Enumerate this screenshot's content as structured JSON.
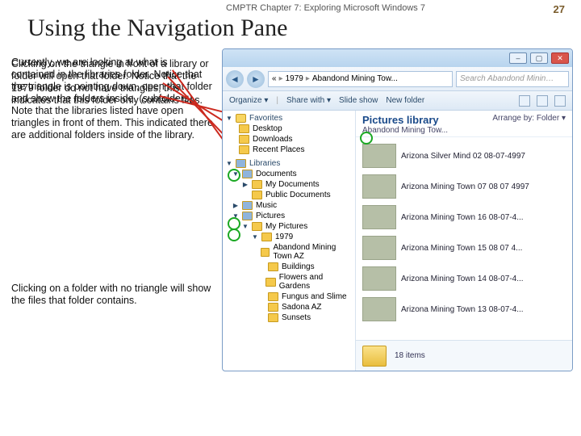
{
  "header": {
    "chapter": "CMPTR Chapter 7: Exploring Microsoft Windows 7",
    "page": "27",
    "title": "Using the Navigation Pane"
  },
  "paragraphs": {
    "p1": "Currently, we are looking at what is contained in the libraries folder. Notice that the triangle is pointing down, open that folder and show the folders inside. (subfolders). Note that the libraries listed have open triangles in front of them. This indicated there are additional folders inside of the library.",
    "p2": "Clicking on the triangle in front of a library or folder will open that folder. Notice that the 1979 folder do not have triangles, this indicates that this folder only contains files.",
    "p3": "Clicking on a folder with no triangle will show the files that folder contains."
  },
  "window": {
    "buttons": {
      "min": "–",
      "max": "▢",
      "close": "✕"
    },
    "nav": {
      "back": "◄",
      "fwd": "►"
    },
    "breadcrumbs": [
      "«",
      "1979",
      "Abandond Mining Tow..."
    ],
    "search_placeholder": "Search Abandond Minin…",
    "toolbar": {
      "organize": "Organize ▾",
      "share": "Share with ▾",
      "slideshow": "Slide show",
      "newfolder": "New folder"
    },
    "library_header": {
      "title": "Pictures library",
      "subtitle": "Abandond Mining Tow...",
      "arrange_label": "Arrange by:",
      "arrange_value": "Folder ▾"
    },
    "status": {
      "count": "18 items"
    }
  },
  "navpane": {
    "favorites": {
      "label": "Favorites",
      "items": [
        {
          "label": "Desktop"
        },
        {
          "label": "Downloads"
        },
        {
          "label": "Recent Places"
        }
      ]
    },
    "libraries": {
      "label": "Libraries",
      "items": [
        {
          "label": "Documents",
          "tri": "open",
          "children": [
            {
              "label": "My Documents",
              "tri": "closed"
            },
            {
              "label": "Public Documents",
              "tri": "none"
            }
          ]
        },
        {
          "label": "Music",
          "tri": "closed"
        },
        {
          "label": "Pictures",
          "tri": "open",
          "children": [
            {
              "label": "My Pictures",
              "tri": "open",
              "children": [
                {
                  "label": "1979",
                  "tri": "open",
                  "children": [
                    {
                      "label": "Abandond Mining Town AZ",
                      "tri": "none"
                    },
                    {
                      "label": "Buildings",
                      "tri": "none"
                    },
                    {
                      "label": "Flowers and Gardens",
                      "tri": "none"
                    },
                    {
                      "label": "Fungus and Slime",
                      "tri": "none"
                    },
                    {
                      "label": "Sadona AZ",
                      "tri": "none"
                    },
                    {
                      "label": "Sunsets",
                      "tri": "none"
                    }
                  ]
                }
              ]
            }
          ]
        }
      ]
    }
  },
  "files": [
    {
      "name": "Arizona Silver Mind 02 08-07-4997"
    },
    {
      "name": "Arizona Mining Town 07 08 07 4997"
    },
    {
      "name": "Arizona Mining Town 16 08-07-4..."
    },
    {
      "name": "Arizona Mining Town 15 08 07 4..."
    },
    {
      "name": "Arizona Mining Town 14 08-07-4..."
    },
    {
      "name": "Arizona Mining Town 13 08-07-4..."
    }
  ]
}
